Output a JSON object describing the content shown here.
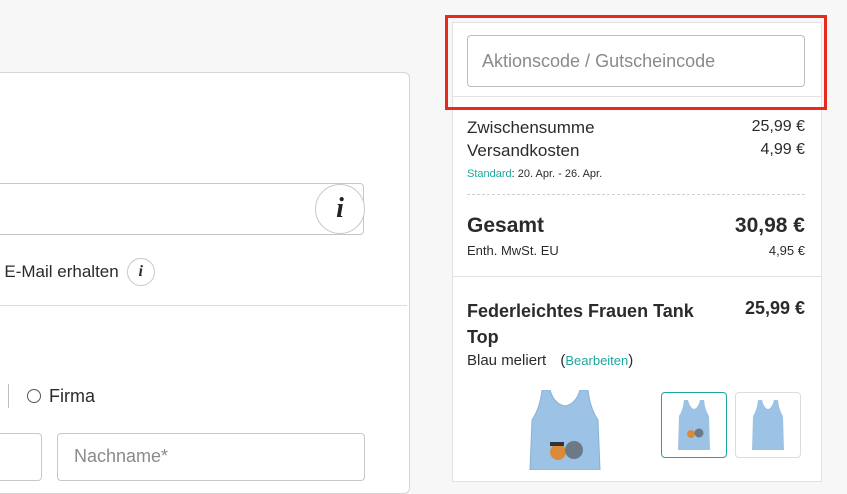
{
  "form": {
    "email_note": "r E-Mail erhalten",
    "info_icon_glyph": "i",
    "option_company": "Firma",
    "last_name_placeholder": "Nachname*"
  },
  "summary": {
    "coupon_placeholder": "Aktionscode / Gutscheincode",
    "subtotal_label": "Zwischensumme",
    "subtotal_value": "25,99 €",
    "shipping_label": "Versandkosten",
    "shipping_value": "4,99 €",
    "shipping_method": "Standard",
    "shipping_dates": ": 20. Apr. - 26. Apr.",
    "total_label": "Gesamt",
    "total_value": "30,98 €",
    "vat_label": "Enth. MwSt. EU",
    "vat_value": "4,95 €"
  },
  "product": {
    "name": "Federleichtes Frauen Tank Top",
    "price": "25,99 €",
    "variant": "Blau meliert",
    "edit_label": "Bearbeiten"
  },
  "colors": {
    "accent": "#1fa59d",
    "highlight": "#e8291d",
    "tank_top": "#9cc3e6"
  }
}
